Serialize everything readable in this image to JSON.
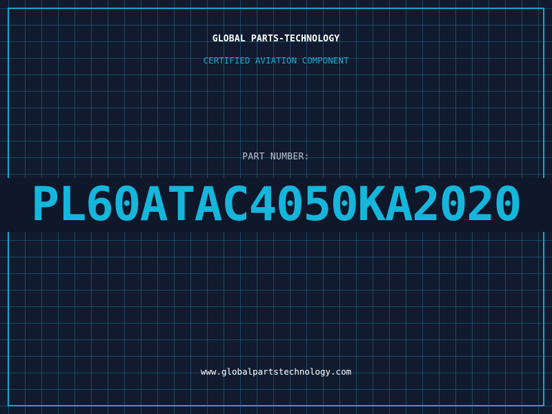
{
  "header": {
    "brand": "GLOBAL PARTS-TECHNOLOGY",
    "subtitle": "CERTIFIED AVIATION COMPONENT"
  },
  "part": {
    "label": "PART NUMBER:",
    "number": "PL60ATAC4050KA2020"
  },
  "footer": {
    "website": "www.globalpartstechnology.com"
  },
  "colors": {
    "background": "#111a2e",
    "grid": "#266e8c",
    "accent": "#1aa6cc",
    "part_number": "#15b6dc",
    "label": "#b8c2d0",
    "text": "#ffffff"
  }
}
